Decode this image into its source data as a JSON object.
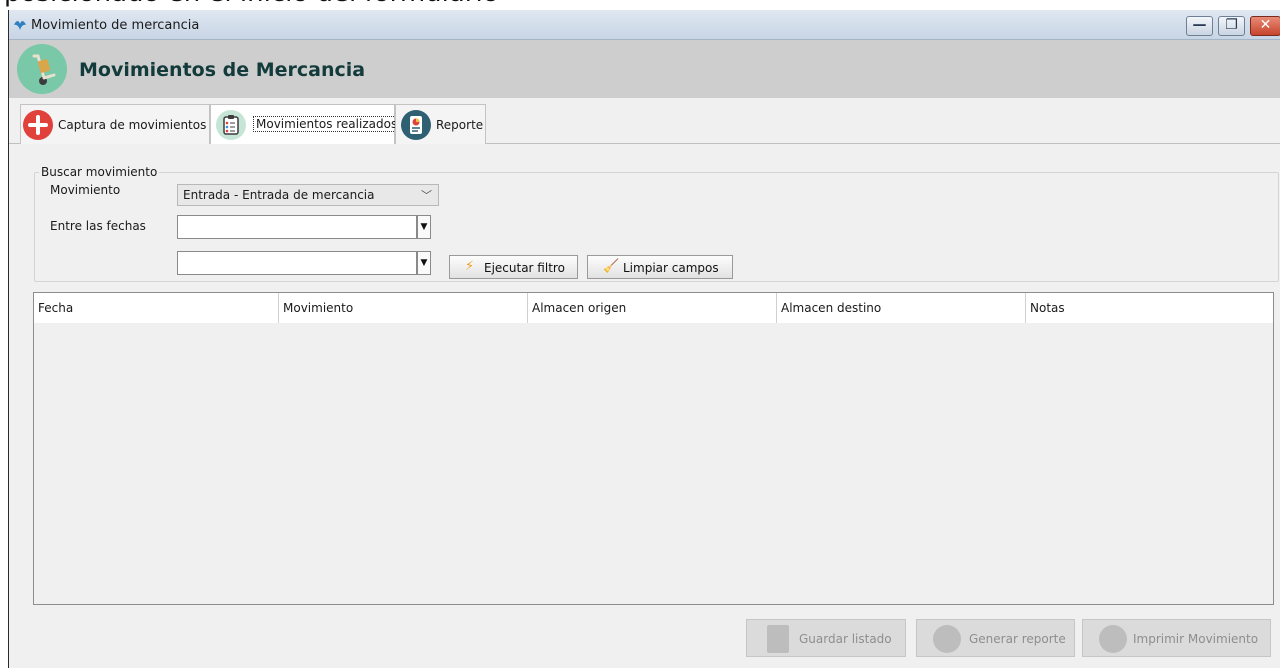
{
  "overlay": {
    "cut_text": "posicionado en el inicio del formulario"
  },
  "window": {
    "title": "Movimiento de mercancia",
    "min_glyph": "—",
    "max_glyph": "❐",
    "close_glyph": "✕"
  },
  "header": {
    "title": "Movimientos de Mercancia"
  },
  "tabs": [
    {
      "label": "Captura de movimientos",
      "icon": "add-icon"
    },
    {
      "label": "Movimientos realizados",
      "icon": "clipboard-icon"
    },
    {
      "label": "Reporte",
      "icon": "report-icon"
    }
  ],
  "search": {
    "legend": "Buscar movimiento",
    "movement_label": "Movimiento",
    "movement_value": "Entrada - Entrada de mercancia",
    "dates_label": "Entre las fechas",
    "date_from_value": "",
    "date_to_value": "",
    "execute_label": "Ejecutar filtro",
    "clear_label": "Limpiar campos"
  },
  "table": {
    "columns": [
      "Fecha",
      "Movimiento",
      "Almacen origen",
      "Almacen destino",
      "Notas"
    ],
    "rows": []
  },
  "actions": {
    "save_list": "Guardar listado",
    "generate_report": "Generar reporte",
    "print_movement": "Imprimir Movimiento"
  },
  "colors": {
    "header_bg": "#cecece",
    "title_text": "#133b3b",
    "logo": "#79c8a8",
    "add_icon": "#e0413b"
  }
}
